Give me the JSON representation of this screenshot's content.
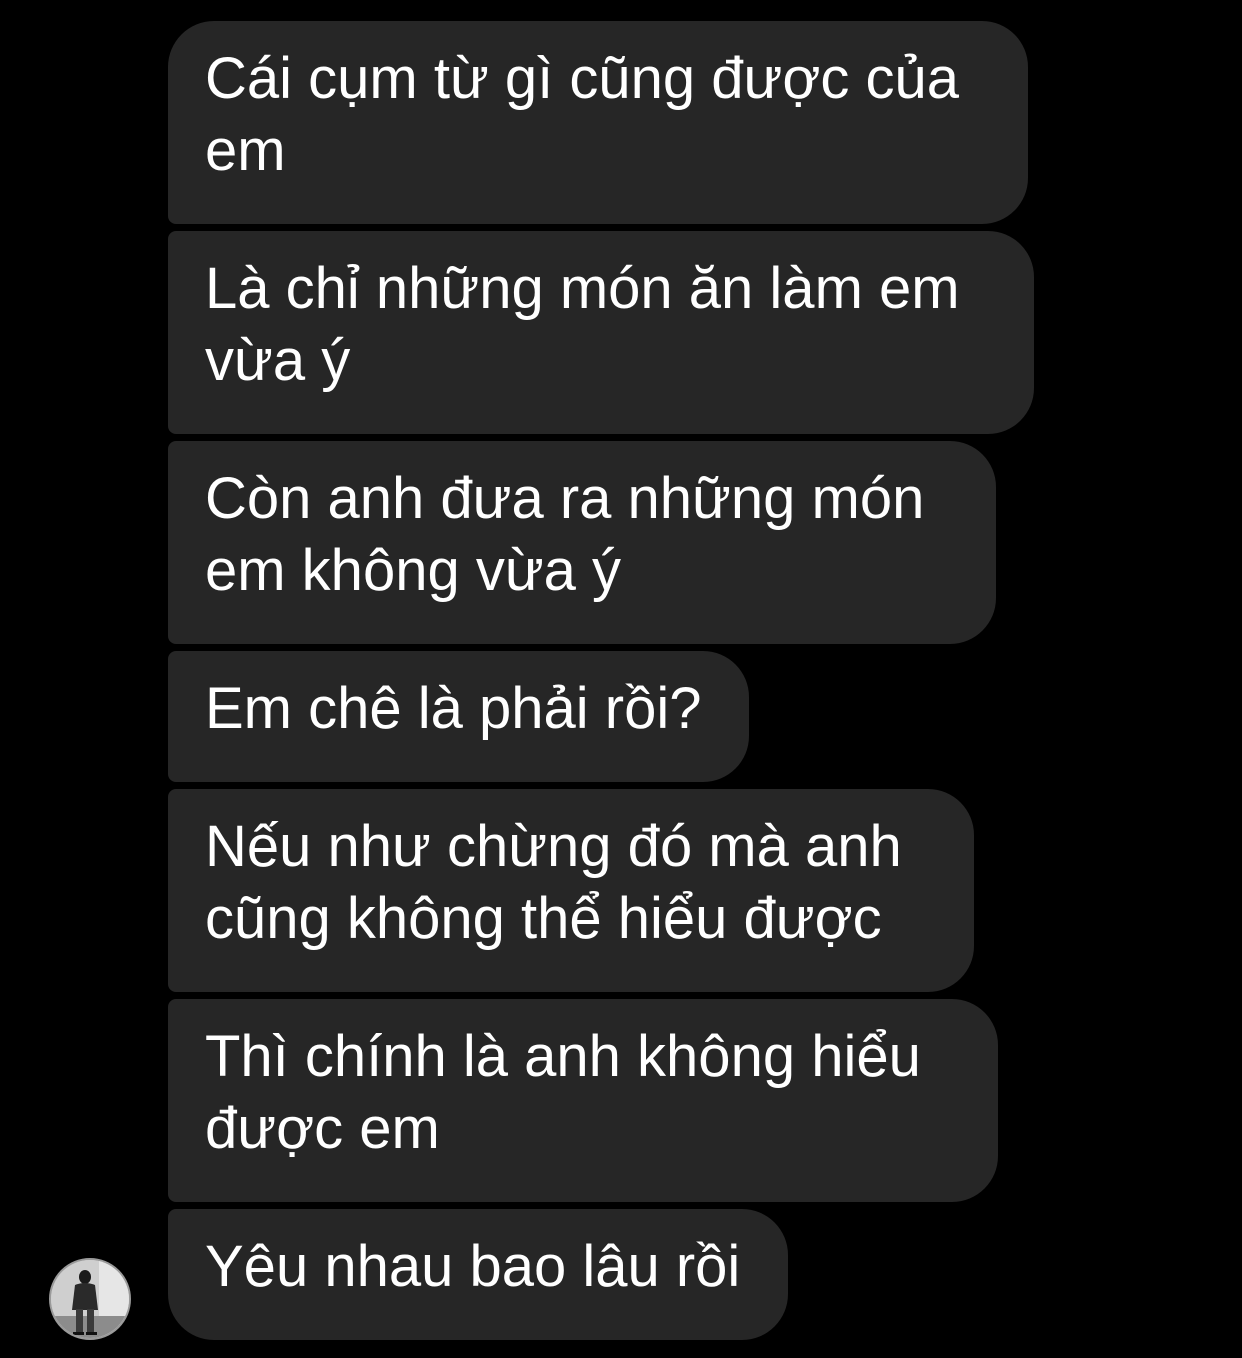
{
  "thread": {
    "messages": [
      {
        "text": "Cái cụm từ gì cũng được của\nem"
      },
      {
        "text": "Là chỉ những món ăn làm em\nvừa ý"
      },
      {
        "text": "Còn anh đưa ra những món\nem không vừa ý"
      },
      {
        "text": "Em chê là phải rồi?"
      },
      {
        "text": "Nếu như chừng đó mà anh\ncũng không thể hiểu được"
      },
      {
        "text": "Thì chính là anh không hiểu\nđược em"
      },
      {
        "text": "Yêu nhau bao lâu rồi"
      }
    ],
    "sender_avatar": {
      "icon": "profile-photo-avatar"
    }
  },
  "colors": {
    "background": "#000000",
    "bubble": "#262626",
    "text": "#ffffff"
  }
}
